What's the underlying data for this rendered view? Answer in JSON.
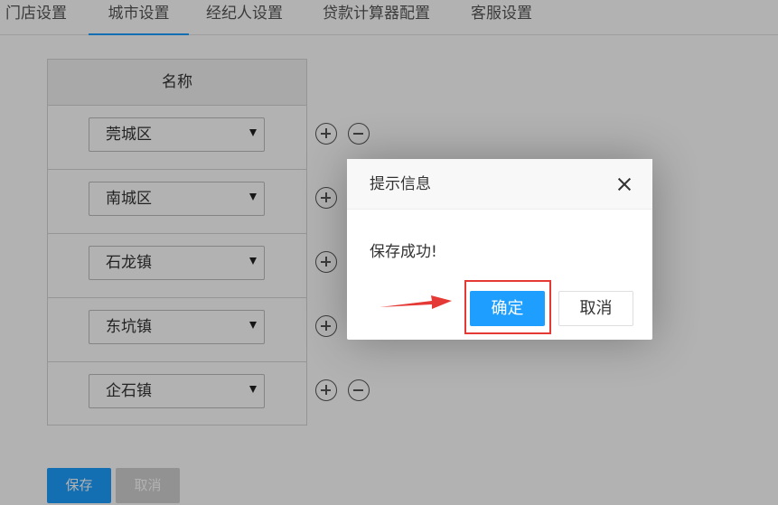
{
  "tabs": [
    {
      "label": "门店设置",
      "active": false
    },
    {
      "label": "城市设置",
      "active": true
    },
    {
      "label": "经纪人设置",
      "active": false
    },
    {
      "label": "贷款计算器配置",
      "active": false
    },
    {
      "label": "客服设置",
      "active": false
    }
  ],
  "table": {
    "header": "名称",
    "rows": [
      {
        "value": "莞城区",
        "has_minus": true
      },
      {
        "value": "南城区",
        "has_minus": false
      },
      {
        "value": "石龙镇",
        "has_minus": false
      },
      {
        "value": "东坑镇",
        "has_minus": false
      },
      {
        "value": "企石镇",
        "has_minus": true
      }
    ]
  },
  "footer": {
    "save_label": "保存",
    "cancel_label": "取消"
  },
  "dialog": {
    "title": "提示信息",
    "message": "保存成功!",
    "ok_label": "确定",
    "cancel_label": "取消"
  },
  "colors": {
    "accent": "#1e9fff",
    "annotation": "#e53935"
  },
  "icons": {
    "add": "plus-circle-icon",
    "remove": "minus-circle-icon",
    "close": "close-icon",
    "dropdown": "caret-down-icon"
  }
}
